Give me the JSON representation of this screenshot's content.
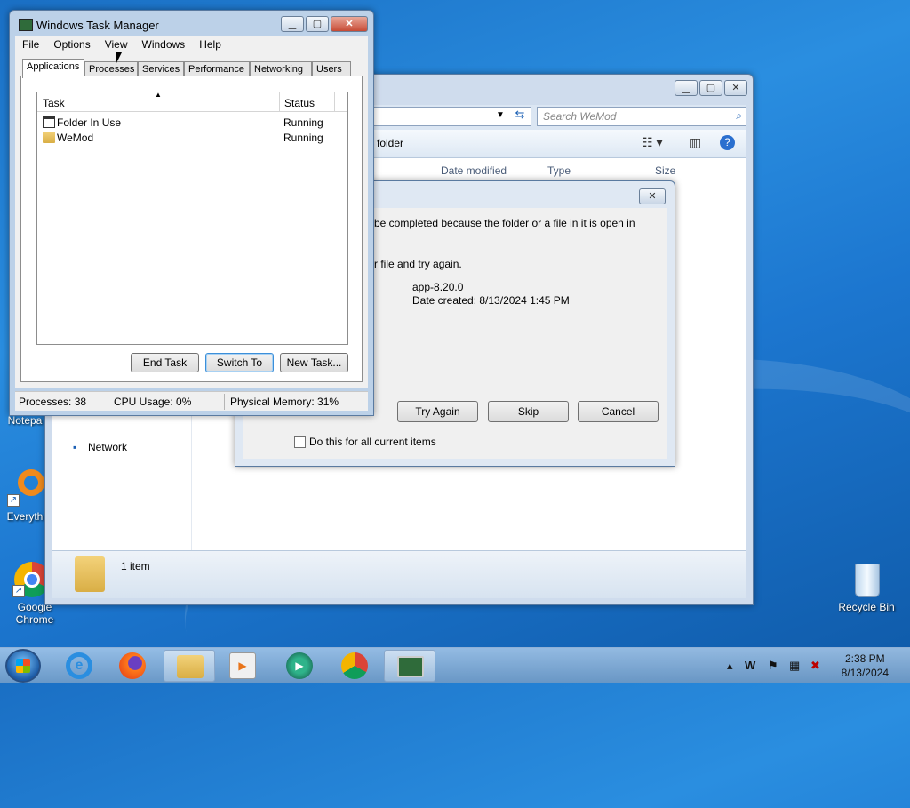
{
  "desktop": {
    "icons": [
      {
        "label": "Notepad",
        "short": true
      },
      {
        "label": "Everything",
        "short": true
      },
      {
        "label": "Google Chrome",
        "short": true
      },
      {
        "label": "Recycle Bin",
        "short": false
      }
    ],
    "partial_labels": [
      "Notepa",
      "Everyth"
    ]
  },
  "explorer": {
    "search_placeholder": "Search WeMod",
    "toolbar_text": "folder",
    "columns": [
      "Date modified",
      "Type",
      "Size"
    ],
    "nav_item": "Network",
    "status_count": "1 item"
  },
  "file_in_use_dialog": {
    "message_line1": "be completed because the folder or a file in it is open in",
    "message_line2": "r file and try again.",
    "file_name": "app-8.20.0",
    "file_date": "Date created: 8/13/2024 1:45 PM",
    "buttons": {
      "try_again": "Try Again",
      "skip": "Skip",
      "cancel": "Cancel"
    },
    "checkbox_label": "Do this for all current items"
  },
  "task_manager": {
    "title": "Windows Task Manager",
    "menu": [
      "File",
      "Options",
      "View",
      "Windows",
      "Help"
    ],
    "tabs": [
      "Applications",
      "Processes",
      "Services",
      "Performance",
      "Networking",
      "Users"
    ],
    "active_tab": "Applications",
    "columns": {
      "task": "Task",
      "status": "Status"
    },
    "rows": [
      {
        "task": "Folder In Use",
        "status": "Running",
        "icon": "window-icon"
      },
      {
        "task": "WeMod",
        "status": "Running",
        "icon": "folder-icon"
      }
    ],
    "buttons": {
      "end_task": "End Task",
      "switch_to": "Switch To",
      "new_task": "New Task..."
    },
    "status": {
      "processes": "Processes: 38",
      "cpu": "CPU Usage: 0%",
      "memory": "Physical Memory: 31%"
    }
  },
  "taskbar": {
    "clock_time": "2:38 PM",
    "clock_date": "8/13/2024",
    "pinned": [
      "internet-explorer",
      "firefox",
      "file-explorer",
      "media-player",
      "wemod",
      "chrome",
      "task-manager"
    ],
    "active_item": "task-manager"
  },
  "colors": {
    "desktop_blue": "#1a6fc4",
    "close_red": "#c74a35",
    "focus_border": "#3c8fd9"
  }
}
